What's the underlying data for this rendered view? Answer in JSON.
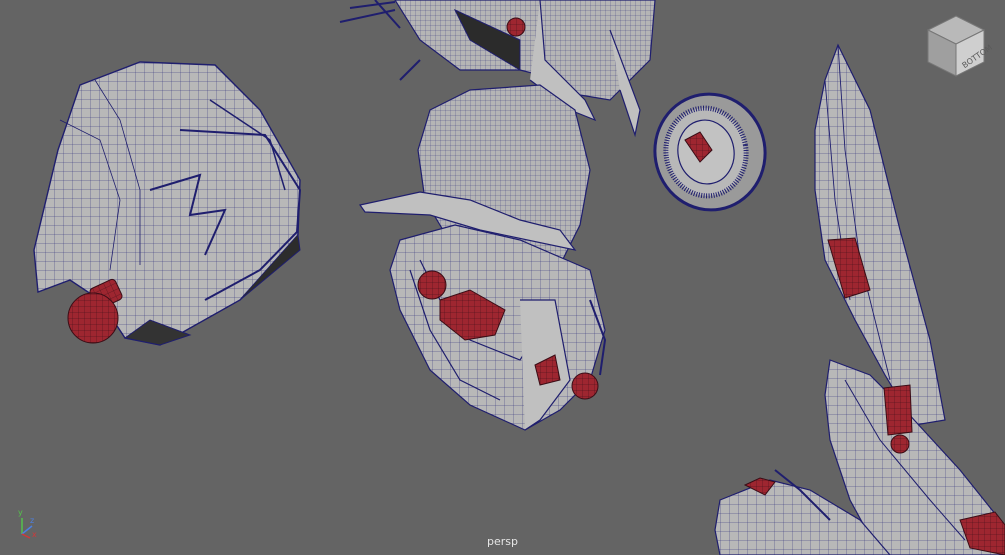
{
  "viewport": {
    "camera_label": "persp",
    "background_color": "#646464",
    "wire_color": "#1f1e6e",
    "surface_color": "#b9b9b9",
    "joint_color": "#9e2630"
  },
  "view_cube": {
    "face_label": "BOTTOM",
    "icon": "view-cube-icon"
  },
  "axis_gizmo": {
    "x_label": "x",
    "y_label": "y",
    "z_label": "z",
    "x_color": "#d0393a",
    "y_color": "#55c24c",
    "z_color": "#4d7fe0"
  }
}
